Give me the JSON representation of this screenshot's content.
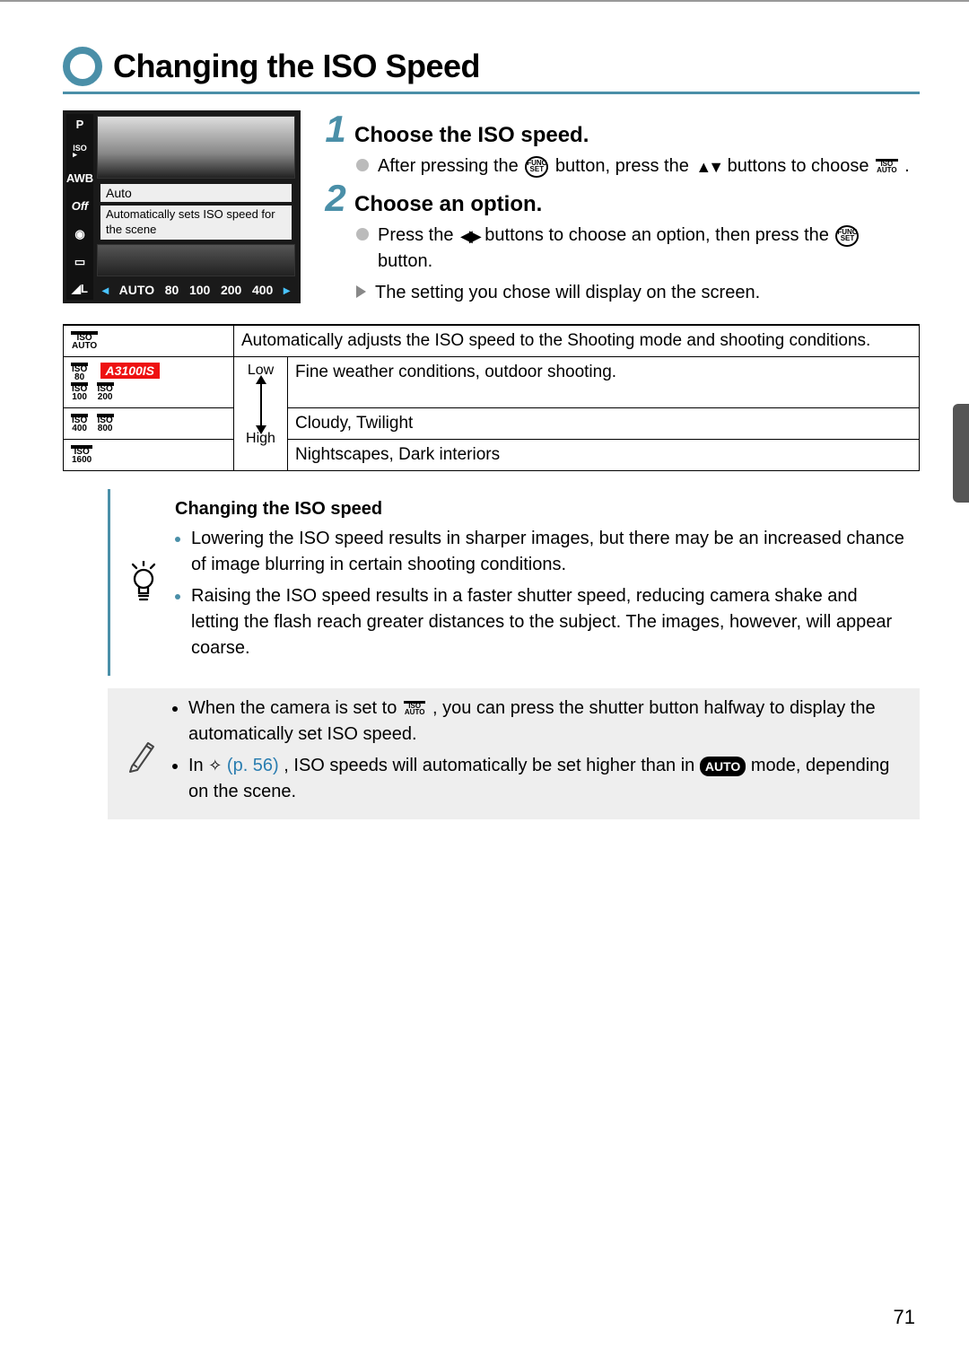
{
  "heading": "Changing the ISO Speed",
  "camera_screenshot": {
    "sidebar_items": [
      "P",
      "ISO",
      "AWB",
      "Off",
      "◉",
      "▭",
      "◢L"
    ],
    "selected_label": "Auto",
    "description": "Automatically sets ISO speed for the scene",
    "bottom_values": [
      "AUTO",
      "80",
      "100",
      "200",
      "400"
    ]
  },
  "steps": [
    {
      "num": "1",
      "title": "Choose the ISO speed.",
      "bullets": [
        {
          "pre": "After pressing the ",
          "mid_icon": "func",
          "mid2": " button, press the ",
          "mid_icon2": "updown",
          "post": " buttons to choose ",
          "end_icon": "iso-auto",
          "end": " ."
        }
      ]
    },
    {
      "num": "2",
      "title": "Choose an option.",
      "bullets": [
        {
          "pre": "Press the ",
          "mid_icon": "leftright",
          "mid2": " buttons to choose an option, then press the ",
          "mid_icon2": "func",
          "post": " button."
        }
      ],
      "result": "The setting you chose will display on the screen."
    }
  ],
  "table": {
    "row_auto": {
      "desc": "Automatically adjusts the ISO speed to the Shooting mode and shooting conditions."
    },
    "scale_low": "Low",
    "scale_high": "High",
    "row_80": {
      "model": "A3100IS",
      "desc": "Fine weather conditions, outdoor shooting."
    },
    "row_mid": {
      "desc": "Cloudy, Twilight"
    },
    "row_1600": {
      "desc": "Nightscapes, Dark interiors"
    }
  },
  "tip_idea": {
    "title": "Changing the ISO speed",
    "items": [
      "Lowering the ISO speed results in sharper images, but there may be an increased chance of image blurring in certain shooting conditions.",
      "Raising the ISO speed results in a faster shutter speed, reducing camera shake and letting the flash reach greater distances to the subject. The images, however, will appear coarse."
    ]
  },
  "tip_note": {
    "items": [
      {
        "pre": "When the camera is set to ",
        "icon": "iso-auto",
        "post": ", you can press the shutter button halfway to display the automatically set ISO speed."
      },
      {
        "pre": "In ",
        "icon": "low-light",
        "ref": "(p. 56)",
        "mid": ", ISO speeds will automatically be set higher than in ",
        "icon2": "auto-pill",
        "post": " mode, depending on the scene."
      }
    ]
  },
  "page_number": "71"
}
